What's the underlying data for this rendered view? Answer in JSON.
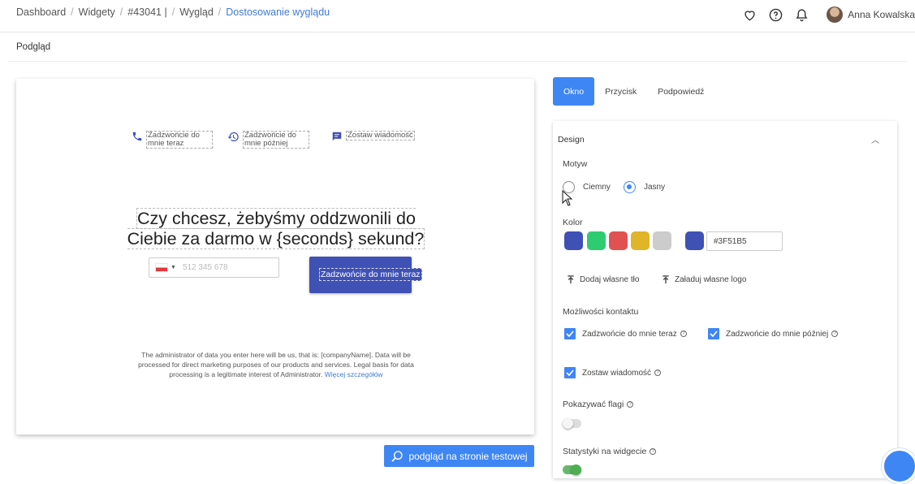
{
  "breadcrumb": {
    "items": [
      "Dashboard",
      "Widgety",
      "#43041 |",
      "Wygląd"
    ],
    "active": "Dostosowanie wyglądu"
  },
  "header": {
    "icons": [
      "heart-icon",
      "help-icon",
      "bell-icon"
    ],
    "user_name": "Anna Kowalska"
  },
  "subheader": {
    "title": "Podgląd"
  },
  "preview": {
    "options": {
      "call_now": "Zadzwońcie do mnie teraz",
      "call_later": "Zadzwońcie do mnie później",
      "leave_message": "Zostaw wiadomość"
    },
    "headline": "Czy chcesz, żebyśmy oddzwonili do Ciebie za darmo w {seconds} sekund?",
    "phone_placeholder": "512 345 678",
    "call_button": "Zadzwońcie do mnie teraz",
    "legal_text": "The administrator of data you enter here will be us, that is: [companyName]. Data will be processed for direct marketing purposes of our products and services. Legal basis for data processing is a legitimate interest of Administrator.",
    "legal_link": "Więcej szczegółów",
    "test_button": "podgląd na stronie testowej"
  },
  "tabs": [
    {
      "label": "Okno",
      "active": true
    },
    {
      "label": "Przycisk",
      "active": false
    },
    {
      "label": "Podpowiedź",
      "active": false
    }
  ],
  "design": {
    "title": "Design",
    "motyw_label": "Motyw",
    "theme_dark": "Ciemny",
    "theme_light": "Jasny",
    "selected_theme": "Jasny",
    "color_label": "Kolor",
    "swatches": [
      "#3f51b5",
      "#2ecc71",
      "#e05252",
      "#e0b528",
      "#cccccc"
    ],
    "selected_color": "#3f51b5",
    "hex_value": "#3F51B5",
    "add_background": "Dodaj własne tło",
    "upload_logo": "Załaduj własne logo",
    "contact_label": "Możliwości kontaktu",
    "contact_call_now": "Zadzwońcie do mnie teraz",
    "contact_call_later": "Zadzwońcie do mnie później",
    "contact_message": "Zostaw wiadomość",
    "flags_label": "Pokazywać flagi",
    "flags_on": false,
    "stats_label": "Statystyki na widgecie",
    "stats_on": true
  },
  "colors": {
    "accent": "#3f86f5",
    "brand": "#3f51b5"
  }
}
